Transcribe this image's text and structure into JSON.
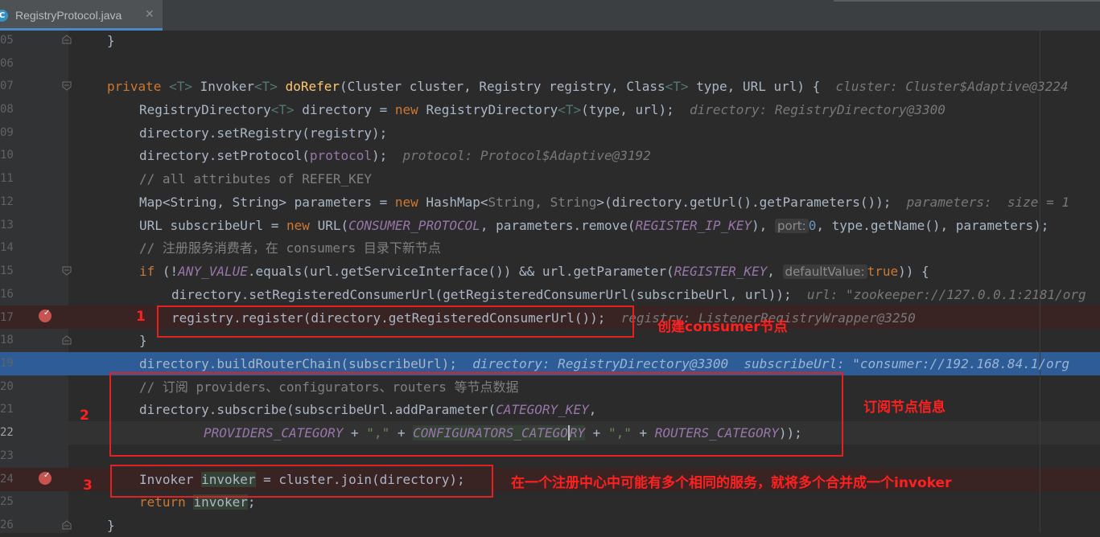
{
  "tab": {
    "icon": "java-class-icon",
    "icon_glyph": "C",
    "label": "RegistryProtocol.java",
    "close": "✕"
  },
  "editor": {
    "line_numbers": [
      "05",
      "06",
      "07",
      "08",
      "09",
      "10",
      "11",
      "12",
      "13",
      "14",
      "15",
      "16",
      "17",
      "18",
      "19",
      "20",
      "21",
      "22",
      "23",
      "24",
      "25",
      "26"
    ],
    "code": {
      "l05_brace": "}",
      "l07": {
        "kw": "private ",
        "tp1": "<T>",
        "t1": " Invoker",
        "tp2": "<T>",
        "t2": " ",
        "fn": "doRefer",
        "t3": "(Cluster cluster, Registry registry, Class",
        "tp3": "<T>",
        "t4": " type, URL url) {",
        "hint": "  cluster: Cluster$Adaptive@3224"
      },
      "l08": {
        "t1": "RegistryDirectory",
        "tp1": "<T>",
        "t2": " directory = ",
        "kw": "new",
        "t3": " RegistryDirectory",
        "tp2": "<T>",
        "t4": "(type, url);",
        "hint": "  directory: RegistryDirectory@3300"
      },
      "l09": "directory.setRegistry(registry);",
      "l10": {
        "t1": "directory.setProtocol(",
        "fd": "protocol",
        "t2": ");",
        "hint": "  protocol: Protocol$Adaptive@3192"
      },
      "l11": "// all attributes of REFER_KEY",
      "l12": {
        "t1": "Map<String, String> parameters = ",
        "kw": "new",
        "t2": " HashMap<",
        "tp": "String, String",
        "t3": ">(directory.getUrl().getParameters());",
        "hint": "  parameters:  size = 1"
      },
      "l13": {
        "t1": "URL subscribeUrl = ",
        "kw": "new",
        "t2": " URL(",
        "cn1": "CONSUMER_PROTOCOL",
        "t3": ", parameters.remove(",
        "cn2": "REGISTER_IP_KEY",
        "t4": "), ",
        "inlay": "port:",
        "nm": "0",
        "t5": ", type.getName(), parameters);"
      },
      "l14": "// 注册服务消费者，在 consumers 目录下新节点",
      "l15": {
        "kw": "if",
        "t1": " (!",
        "cn1": "ANY_VALUE",
        "t2": ".equals(url.getServiceInterface()) && url.getParameter(",
        "cn2": "REGISTER_KEY",
        "t3": ", ",
        "inlay": "defaultValue:",
        "kw2": "true",
        "t4": ")) {"
      },
      "l16": {
        "t1": "directory.setRegisteredConsumerUrl(getRegisteredConsumerUrl(subscribeUrl, url));",
        "hint": "  url: \"zookeeper://127.0.0.1:2181/org"
      },
      "l17": {
        "t1": "registry.register(directory.getRegisteredConsumerUrl());",
        "hint": "  registry: ListenerRegistryWrapper@3250"
      },
      "l18": "}",
      "l19": {
        "t1": "directory.buildRouterChain(subscribeUrl);",
        "hint": "  directory: RegistryDirectory@3300  subscribeUrl: \"consumer://192.168.84.1/org"
      },
      "l20": "// 订阅 providers、configurators、routers 等节点数据",
      "l21": {
        "t1": "directory.subscribe(subscribeUrl.addParameter(",
        "cn": "CATEGORY_KEY",
        "t2": ","
      },
      "l22": {
        "cn1": "PROVIDERS_CATEGORY",
        "t1": " + ",
        "st1": "\",\"",
        "t2": " + ",
        "cn2a": "CONFIGURATORS_CATEGO",
        "cn2b": "RY",
        "t3": " + ",
        "st2": "\",\"",
        "t4": " + ",
        "cn3": "ROUTERS_CATEGORY",
        "t5": "));"
      },
      "l24": {
        "t1": "Invoker ",
        "hl": "invoker",
        "t2": " = cluster.join(directory);"
      },
      "l25": {
        "kw": "return",
        "t1": " ",
        "hl": "invoker",
        "t2": ";"
      },
      "l26": "}"
    }
  },
  "annotations": {
    "n1": "1",
    "n2": "2",
    "n3": "3",
    "a1": "创建consumer节点",
    "a2": "订阅节点信息",
    "a3": "在一个注册中心中可能有多个相同的服务，就将多个合并成一个invoker"
  },
  "colors": {
    "editor_bg": "#2b2b2b",
    "keyword": "#cc7832",
    "constant": "#9876aa",
    "comment": "#808080",
    "selection_line": "#2d5c96",
    "breakpoint_line": "#3a2323",
    "annotation_red": "#ff2020"
  }
}
